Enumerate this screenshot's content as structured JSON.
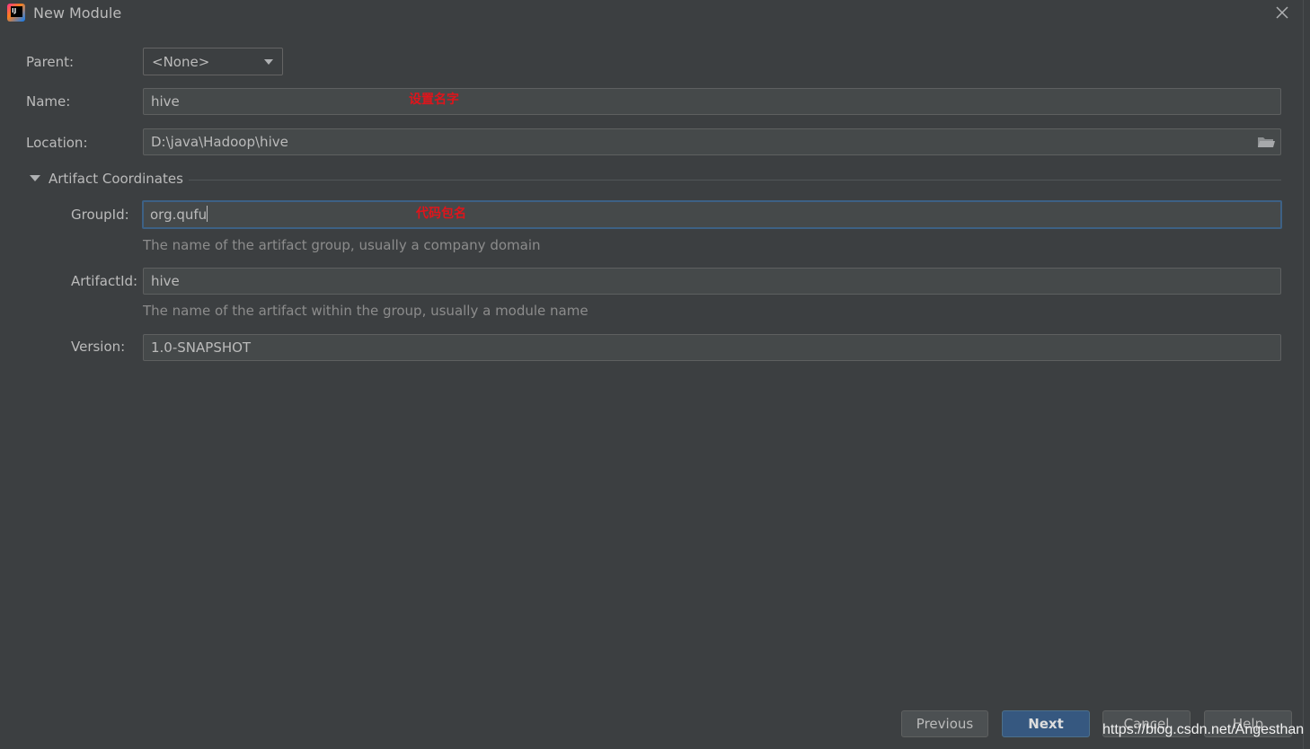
{
  "window": {
    "title": "New Module"
  },
  "form": {
    "parent": {
      "label": "Parent:",
      "value": "<None>"
    },
    "name": {
      "label": "Name:",
      "value": "hive",
      "annotation": "设置名字"
    },
    "location": {
      "label": "Location:",
      "value": "D:\\java\\Hadoop\\hive"
    }
  },
  "artifact": {
    "section_title": "Artifact Coordinates",
    "group_id": {
      "label": "GroupId:",
      "value": "org.qufu",
      "hint": "The name of the artifact group, usually a company domain",
      "annotation": "代码包名"
    },
    "artifact_id": {
      "label": "ArtifactId:",
      "value": "hive",
      "hint": "The name of the artifact within the group, usually a module name"
    },
    "version": {
      "label": "Version:",
      "value": "1.0-SNAPSHOT"
    }
  },
  "buttons": {
    "previous": "Previous",
    "next": "Next",
    "cancel": "Cancel",
    "help": "Help"
  },
  "watermark": "https://blog.csdn.net/Angesthan",
  "colors": {
    "background": "#3c3f41",
    "field_bg": "#45494a",
    "focus_border": "#3d6185",
    "primary_button": "#365880",
    "annotation_red": "#e0141b"
  }
}
